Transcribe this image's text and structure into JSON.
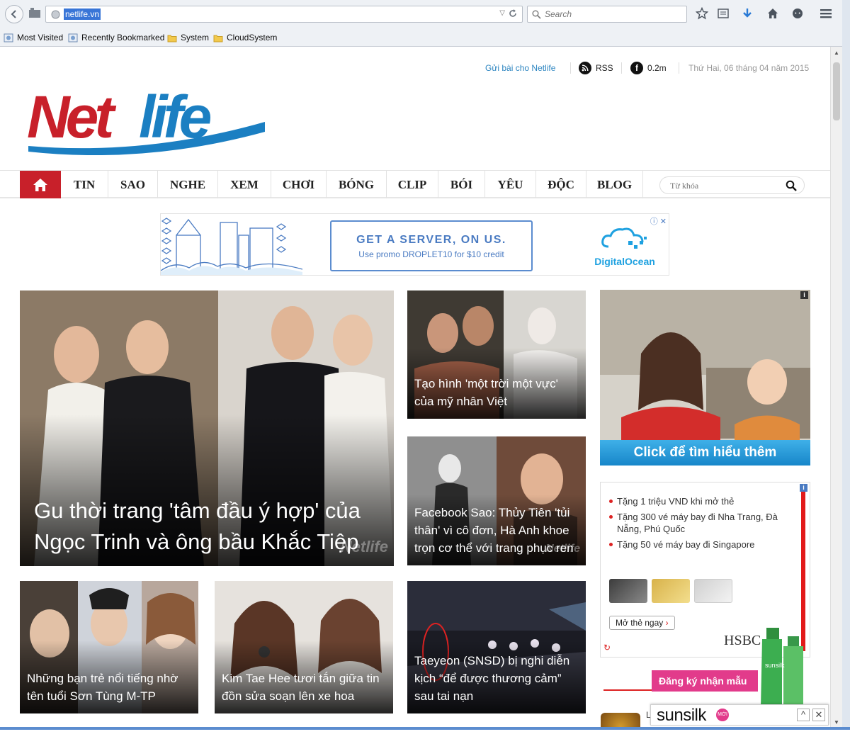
{
  "browser": {
    "url": "netlife.vn",
    "search_placeholder": "Search",
    "bookmarks": [
      "Most Visited",
      "Recently Bookmarked",
      "System",
      "CloudSystem"
    ]
  },
  "header": {
    "send_post": "Gửi bài cho Netlife",
    "rss": "RSS",
    "fb_count": "0.2m",
    "date": "Thứ Hai, 06 tháng 04 năm 2015"
  },
  "menu": {
    "items": [
      "TIN",
      "SAO",
      "NGHE",
      "XEM",
      "CHƠI",
      "BÓNG",
      "CLIP",
      "BÓI",
      "YÊU",
      "ĐỘC",
      "BLOG"
    ],
    "search_placeholder": "Từ khóa"
  },
  "banner_ad": {
    "headline": "GET A SERVER, ON US.",
    "subline": "Use promo DROPLET10 for $10 credit",
    "brand": "DigitalOcean"
  },
  "articles": {
    "featured": "Gu thời trang 'tâm đầu ý hợp' của Ngọc Trinh và ông bầu Khắc Tiệp",
    "a1": "Tạo hình 'một trời một vực' của mỹ nhân Việt",
    "a2": "Facebook Sao: Thủy Tiên 'tủi thân' vì cô đơn, Hà Anh khoe trọn cơ thể với trang phục ren",
    "a3": "Những bạn trẻ nổi tiếng nhờ tên tuổi Sơn Tùng M-TP",
    "a4": "Kim Tae Hee tươi tắn giữa tin đồn sửa soạn lên xe hoa",
    "a5": "Taeyeon (SNSD) bị nghi diễn kịch “để được thương cảm” sau tai nạn"
  },
  "side_ad": {
    "cta": "Click để tìm hiểu thêm"
  },
  "hsbc_ad": {
    "bullets": [
      "Tặng 1 triệu VND khi mở thẻ",
      "Tặng 300 vé máy bay đi Nha Trang, Đà Nẵng, Phú Quốc",
      "Tặng 50 vé máy bay đi Singapore"
    ],
    "button": "Mở thẻ ngay",
    "brand": "HSBC"
  },
  "sunsilk_ad": {
    "promo": "Đăng ký nhận mẫu thử",
    "brand": "sunsilk",
    "badge": "MỚI"
  },
  "colors": {
    "brand_red": "#c8202a",
    "brand_blue": "#2e86c1"
  }
}
